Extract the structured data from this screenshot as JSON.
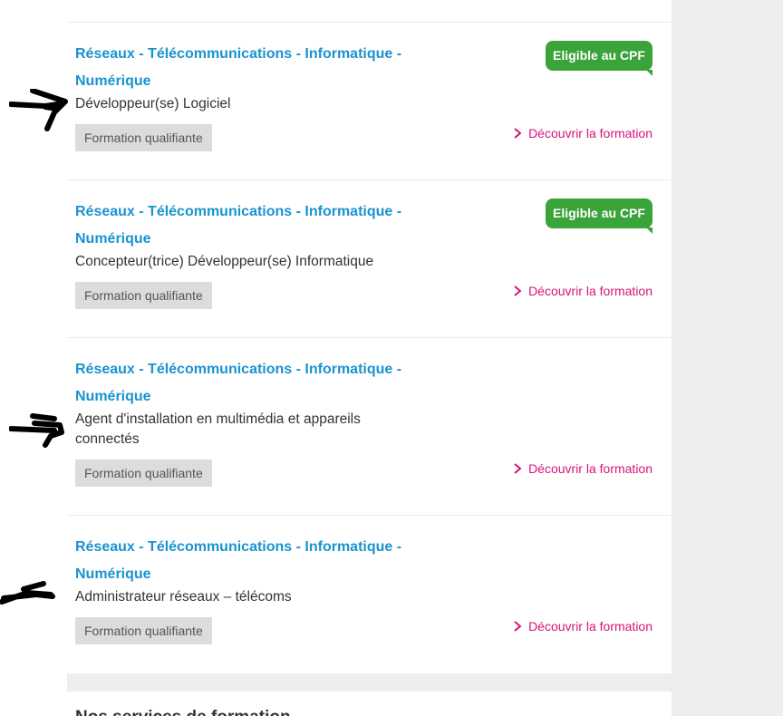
{
  "results": [
    {
      "domain": "Réseaux - Télécommunications - Informatique - Numérique",
      "title": "Développeur(se) Logiciel",
      "type": "Formation qualifiante",
      "cpf": "Eligible au CPF",
      "link": "Découvrir la formation"
    },
    {
      "domain": "Réseaux - Télécommunications - Informatique - Numérique",
      "title": "Concepteur(trice) Développeur(se) Informatique",
      "type": "Formation qualifiante",
      "cpf": "Eligible au CPF",
      "link": "Découvrir la formation"
    },
    {
      "domain": "Réseaux - Télécommunications - Informatique - Numérique",
      "title": "Agent d'installation en multimédia et appareils connectés",
      "type": "Formation qualifiante",
      "link": "Découvrir la formation"
    },
    {
      "domain": "Réseaux - Télécommunications - Informatique - Numérique",
      "title": "Administrateur réseaux – télécoms",
      "type": "Formation qualifiante",
      "link": "Découvrir la formation"
    }
  ],
  "footer": {
    "section_title": "Nos services de formation"
  },
  "colors": {
    "domain": "#1a93d0",
    "cpf": "#3aa33a",
    "link": "#d6147a",
    "type_badge": "#dcdcdc",
    "gutter": "#eeeeee"
  }
}
